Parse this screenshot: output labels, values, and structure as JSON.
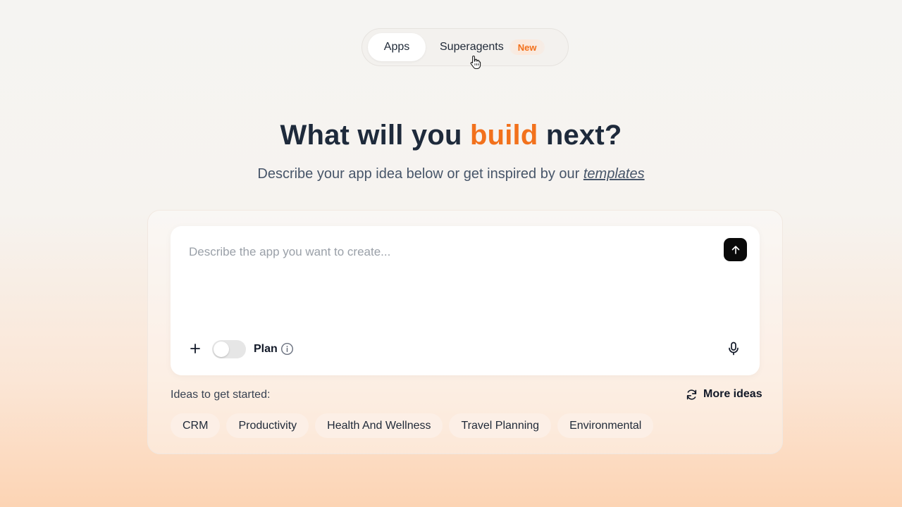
{
  "mode_switch": {
    "apps_label": "Apps",
    "superagents_label": "Superagents",
    "new_badge": "New"
  },
  "hero": {
    "title_pre": "What will you ",
    "title_accent": "build",
    "title_post": " next?",
    "subtitle": "Describe your app idea below or get inspired by our ",
    "subtitle_link": "templates"
  },
  "prompt": {
    "placeholder": "Describe the app you want to create...",
    "plan_label": "Plan",
    "plan_enabled": false
  },
  "ideas": {
    "label": "Ideas to get started:",
    "more_label": "More ideas",
    "chips": [
      "CRM",
      "Productivity",
      "Health And Wellness",
      "Travel Planning",
      "Environmental"
    ]
  },
  "colors": {
    "accent": "#f2711c",
    "send_button": "#0a0a0a",
    "chip_bg": "#fcefe6"
  },
  "icons": {
    "send": "arrow-up-icon",
    "add": "plus-icon",
    "info": "info-icon",
    "mic": "microphone-icon",
    "refresh": "refresh-icon",
    "cursor": "hand-pointer-icon"
  }
}
